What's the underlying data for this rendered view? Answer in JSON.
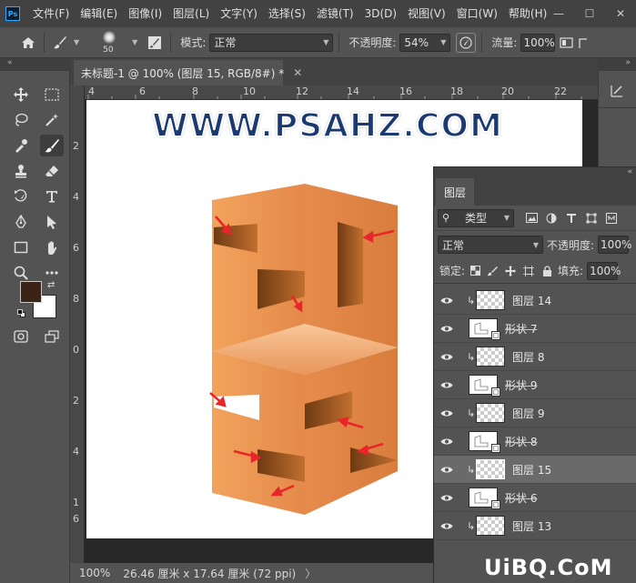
{
  "menubar": {
    "logo": "Ps",
    "items": [
      "文件(F)",
      "编辑(E)",
      "图像(I)",
      "图层(L)",
      "文字(Y)",
      "选择(S)",
      "滤镜(T)",
      "3D(D)",
      "视图(V)",
      "窗口(W)",
      "帮助(H)"
    ],
    "window_controls": [
      "—",
      "☐",
      "✕"
    ]
  },
  "options": {
    "brush_size": "50",
    "mode_label": "模式:",
    "mode_value": "正常",
    "opacity_label": "不透明度:",
    "opacity_value": "54%",
    "flow_label": "流量:",
    "flow_value": "100%"
  },
  "document": {
    "tab_title": "未标题-1 @ 100% (图层 15, RGB/8#) *",
    "close": "✕",
    "canvas_heading": "WWW.PSAHZ.COM"
  },
  "rulers": {
    "h": [
      "4",
      "6",
      "8",
      "10",
      "12",
      "14",
      "16",
      "18",
      "20",
      "22"
    ],
    "v": [
      "2",
      "4",
      "6",
      "8",
      "0",
      "2",
      "4",
      "1",
      "6"
    ]
  },
  "status": {
    "zoom": "100%",
    "doc_info": "26.46 厘米 x 17.64 厘米 (72 ppi)",
    "arrow": "〉"
  },
  "layers_panel": {
    "tab": "图层",
    "filter_label": "类型",
    "blend_mode": "正常",
    "opacity_label": "不透明度:",
    "opacity_value": "100%",
    "lock_label": "锁定:",
    "fill_label": "填充:",
    "fill_value": "100%",
    "layers": [
      {
        "name": "图层 14",
        "type": "pixel",
        "clipped": true,
        "selected": false
      },
      {
        "name": "形状 7",
        "type": "shape",
        "clipped": false,
        "selected": false
      },
      {
        "name": "图层 8",
        "type": "pixel",
        "clipped": true,
        "selected": false
      },
      {
        "name": "形状 9",
        "type": "shape",
        "clipped": false,
        "selected": false
      },
      {
        "name": "图层 9",
        "type": "pixel",
        "clipped": true,
        "selected": false
      },
      {
        "name": "形状 8",
        "type": "shape",
        "clipped": false,
        "selected": false
      },
      {
        "name": "图层 15",
        "type": "pixel",
        "clipped": true,
        "selected": true
      },
      {
        "name": "形状 6",
        "type": "shape",
        "clipped": false,
        "selected": false
      },
      {
        "name": "图层 13",
        "type": "pixel",
        "clipped": true,
        "selected": false
      }
    ]
  },
  "watermark": "UiBQ.CoM",
  "colors": {
    "foreground": "#3b2416",
    "background": "#ffffff",
    "orange_light": "#f0a058",
    "orange_mid": "#e0874a",
    "orange_dark": "#a8581f",
    "arrow_red": "#e8262a",
    "heading_blue": "#1c3a72"
  },
  "icons": [
    "home-icon",
    "brush-icon",
    "airbrush-icon",
    "pressure-icon",
    "move-icon",
    "marquee-icon",
    "lasso-icon",
    "magic-wand-icon",
    "eyedropper-icon",
    "stamp-icon",
    "eraser-icon",
    "history-brush-icon",
    "type-icon",
    "pen-icon",
    "path-select-icon",
    "rectangle-icon",
    "hand-icon",
    "zoom-icon",
    "more-icon",
    "eye-icon",
    "clip-icon"
  ]
}
